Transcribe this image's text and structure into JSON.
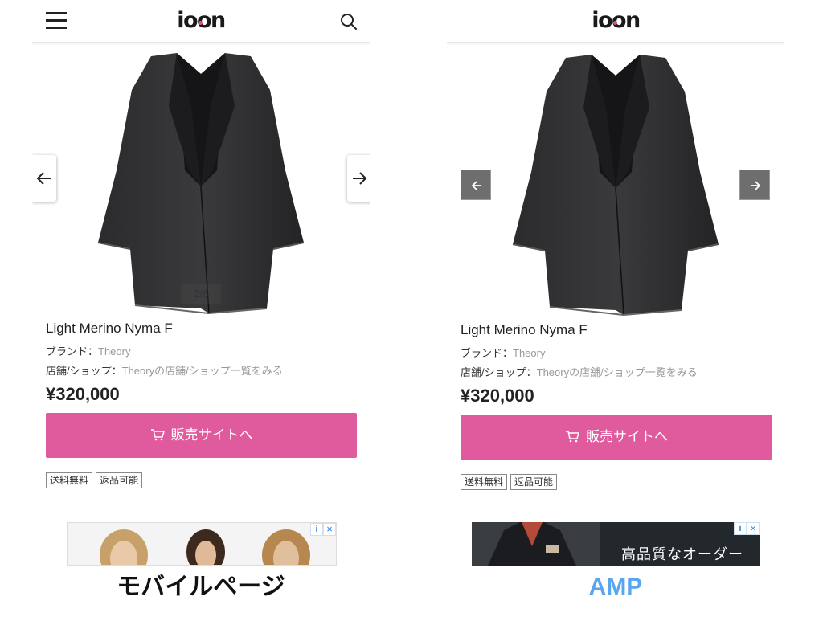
{
  "left": {
    "logo": "ioon",
    "menu_icon": "hamburger-menu-icon",
    "search_icon": "search-icon",
    "counter": "2/6",
    "product": {
      "name": "Light Merino Nyma F",
      "brand_label": "ブランド：",
      "brand_value": "Theory",
      "shop_label": "店舗/ショップ：",
      "shop_value": "Theoryの店舗/ショップ一覧をみる",
      "price": "¥320,000",
      "buy_label": "販売サイトへ",
      "badges": [
        "送料無料",
        "返品可能"
      ]
    },
    "caption": "モバイルページ"
  },
  "right": {
    "logo": "ioon",
    "product": {
      "name": "Light Merino Nyma F",
      "brand_label": "ブランド：",
      "brand_value": "Theory",
      "shop_label": "店舗/ショップ：",
      "shop_value": "Theoryの店舗/ショップ一覧をみる",
      "price": "¥320,000",
      "buy_label": "販売サイトへ",
      "badges": [
        "送料無料",
        "返品可能"
      ]
    },
    "ad_text": "高品質なオーダー",
    "caption": "AMP"
  },
  "colors": {
    "accent": "#e05a9e",
    "amp_caption": "#5aa6ee",
    "ad_choice": "#2a7fd9"
  }
}
